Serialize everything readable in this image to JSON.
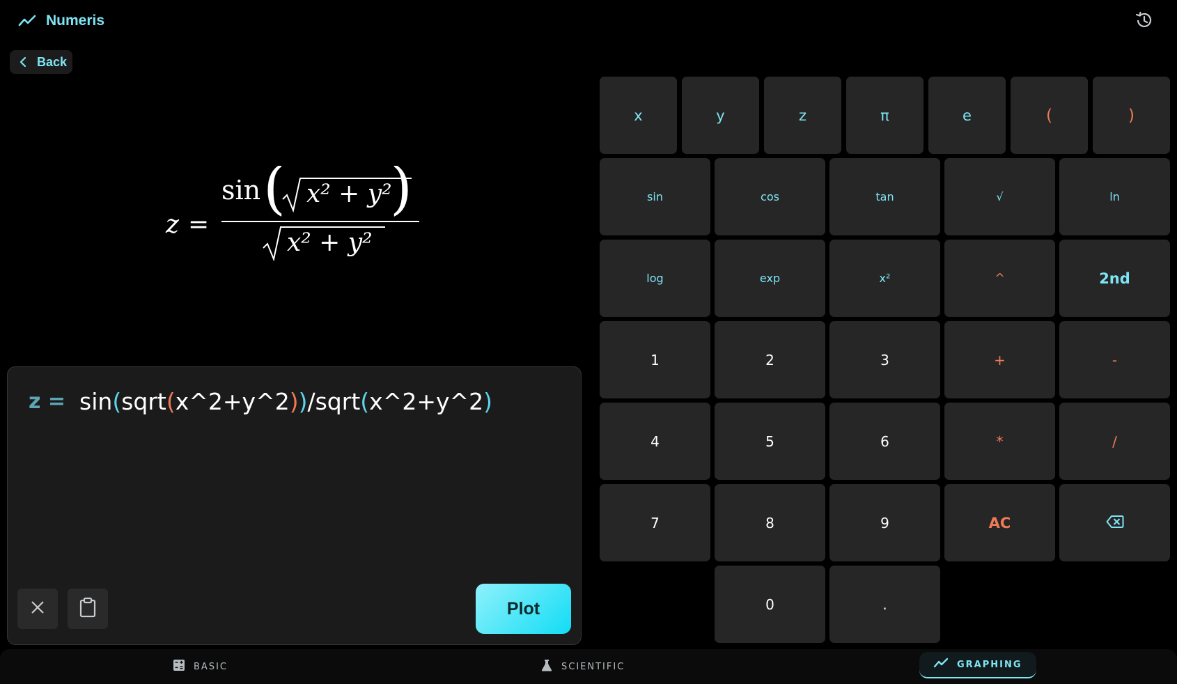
{
  "app": {
    "title": "Numeris"
  },
  "header": {
    "back_label": "Back",
    "history_icon": "history-icon"
  },
  "formula": {
    "lhs": "z",
    "equals": "=",
    "numerator_fn": "sin",
    "radicand": "x² + y²"
  },
  "editor": {
    "lhs": "z =",
    "expression_parts": [
      "sin",
      "(",
      "sqrt",
      "(",
      "x^2+y^2",
      ")",
      ")",
      "/sqrt",
      "(",
      "x^2+y^2",
      ")"
    ],
    "plot_label": "Plot"
  },
  "keypad": {
    "row1": [
      "x",
      "y",
      "z",
      "π",
      "e",
      "(",
      ")"
    ],
    "row2": [
      "sin",
      "cos",
      "tan",
      "√",
      "ln"
    ],
    "row3": [
      "log",
      "exp",
      "x²",
      "^",
      "2nd"
    ],
    "row4": [
      "1",
      "2",
      "3",
      "+",
      "-"
    ],
    "row5": [
      "4",
      "5",
      "6",
      "*",
      "/"
    ],
    "row6": [
      "7",
      "8",
      "9",
      "AC"
    ],
    "row7": [
      "0",
      "."
    ]
  },
  "nav": {
    "basic": "BASIC",
    "scientific": "SCIENTIFIC",
    "graphing": "GRAPHING"
  },
  "colors": {
    "accent": "#7fe5f5",
    "operator": "#ee7a55",
    "key_bg": "#262626",
    "background": "#000000"
  }
}
